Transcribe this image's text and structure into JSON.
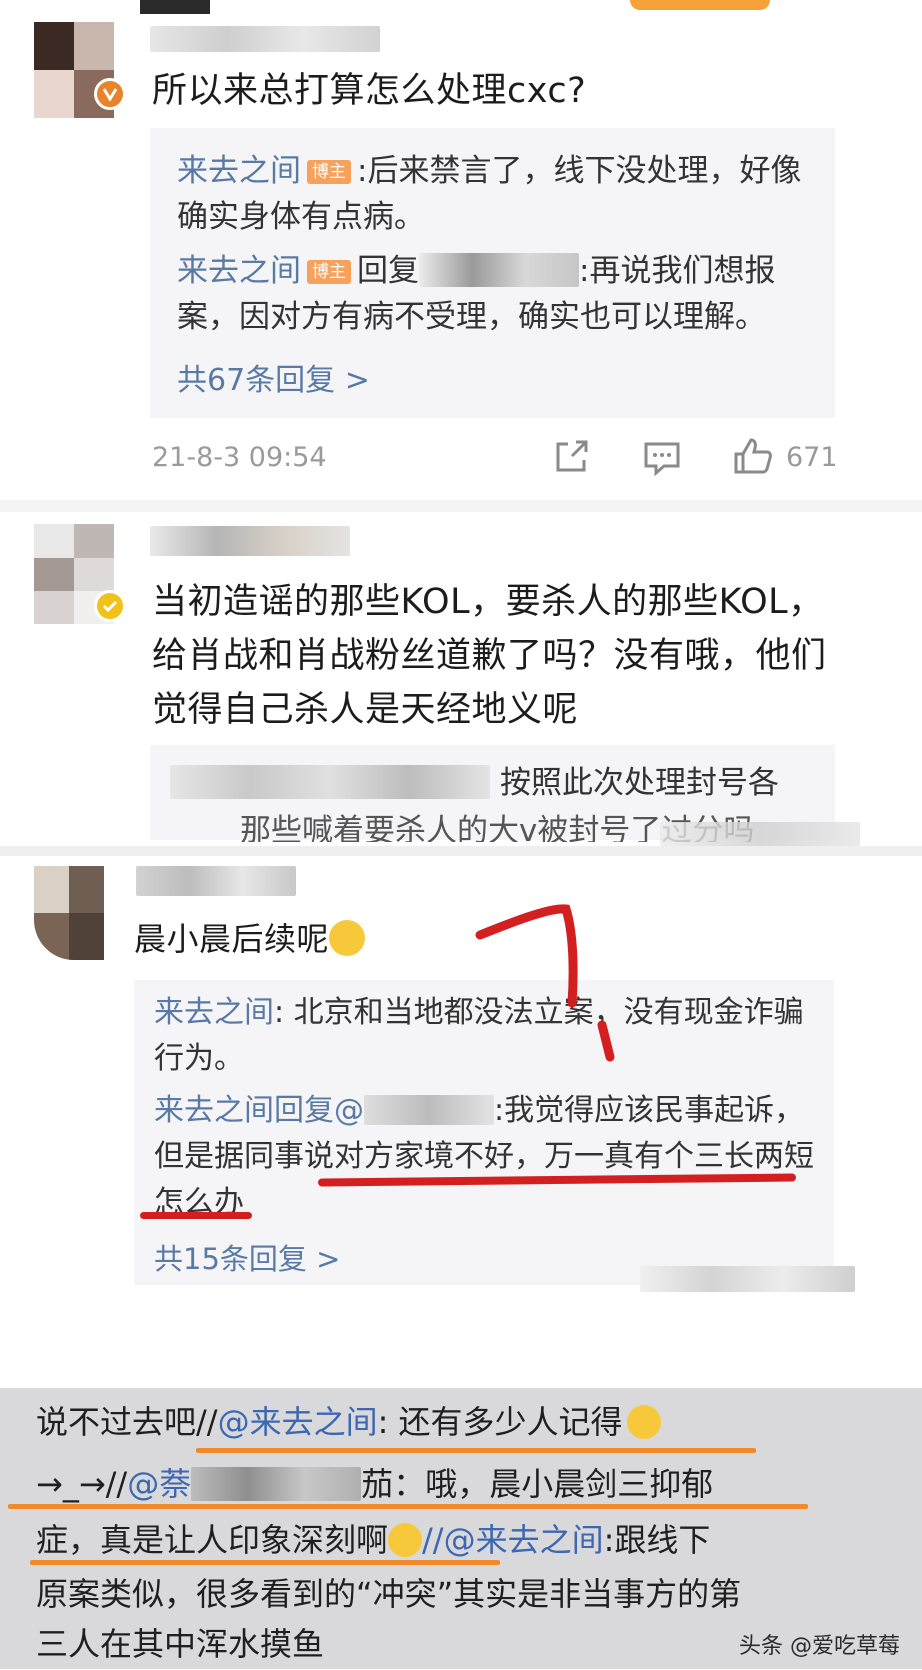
{
  "comment1": {
    "text": "所以来总打算怎么处理cxc?",
    "replies": [
      {
        "user": "来去之间",
        "tag": "博主",
        "text": ":后来禁言了，线下没处理，好像",
        "text2": "确实身体有点病。"
      },
      {
        "user": "来去之间",
        "tag": "博主",
        "text": "回复",
        "text_after": ":再说我们想报",
        "text2": "案，因对方有病不受理，确实也可以理解。"
      }
    ],
    "more": "共67条回复 >",
    "time": "21-8-3 09:54",
    "likes": "671"
  },
  "comment2": {
    "text_lines": [
      "当初造谣的那些KOL，要杀人的那些KOL，",
      "给肖战和肖战粉丝道歉了吗？没有哦，他们",
      "觉得自己杀人是天经地义呢"
    ],
    "reply_line1": "按照此次处理封号各",
    "reply_line2": "那些喊着要杀人的大v被封号了过分吗"
  },
  "comment3": {
    "text": "晨小晨后续呢",
    "replies": [
      {
        "user": "来去之间",
        "text": ": 北京和当地都没法立案，没有现金诈骗",
        "text2": "行为。"
      },
      {
        "user": "来去之间",
        "text": "回复@",
        "text_after": ":我觉得应该民事起诉，",
        "text2": "但是据同事说对方家境不好，万一真有个三长两短",
        "text3": "怎么办"
      }
    ],
    "more": "共15条回复 >"
  },
  "bottom": {
    "line1_a": "说不过去吧//",
    "line1_user": "@来去之间",
    "line1_b": ": 还有多少人记得",
    "line2_a": "→_→//",
    "line2_user": "@萘",
    "line2_b": "茄：哦，晨小晨剑三抑郁",
    "line3_a": "症，真是让人印象深刻啊",
    "line3_user": "//@来去之间",
    "line3_b": ":跟线下",
    "line4": "原案类似，很多看到的“冲突”其实是非当事方的第",
    "line5": "三人在其中浑水摸鱼"
  },
  "watermark": "头条 @爱吃草莓",
  "colors": {
    "link": "#5a7aa6",
    "tag": "#f7a25c",
    "red_annotation": "#d31f1f",
    "orange_annotation": "#f08a2a"
  }
}
